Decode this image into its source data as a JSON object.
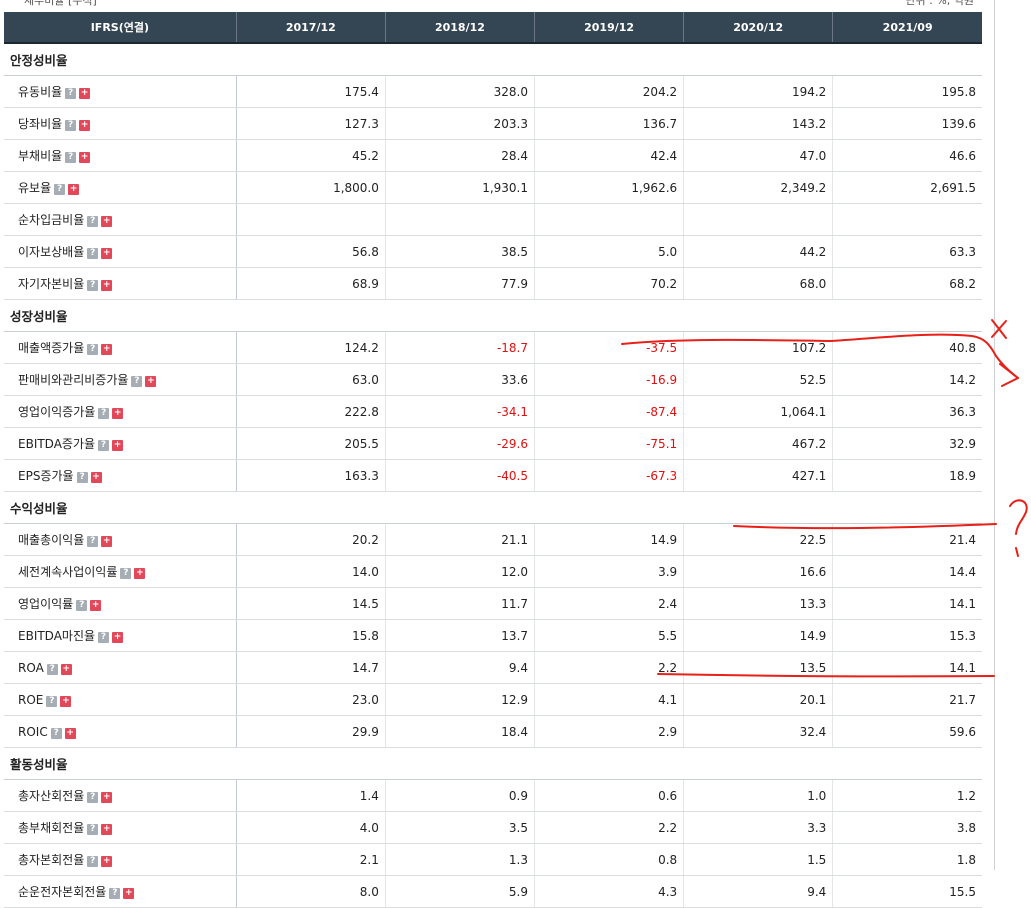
{
  "top": {
    "left_fragment": "재무비율 [누적]",
    "right_fragment": "단위 : %, 억원"
  },
  "header": [
    "IFRS(연결)",
    "2017/12",
    "2018/12",
    "2019/12",
    "2020/12",
    "2021/09"
  ],
  "sections": [
    {
      "title": "안정성비율",
      "rows": [
        {
          "label": "유동비율",
          "values": [
            "175.4",
            "328.0",
            "204.2",
            "194.2",
            "195.8"
          ]
        },
        {
          "label": "당좌비율",
          "values": [
            "127.3",
            "203.3",
            "136.7",
            "143.2",
            "139.6"
          ]
        },
        {
          "label": "부채비율",
          "values": [
            "45.2",
            "28.4",
            "42.4",
            "47.0",
            "46.6"
          ]
        },
        {
          "label": "유보율",
          "values": [
            "1,800.0",
            "1,930.1",
            "1,962.6",
            "2,349.2",
            "2,691.5"
          ]
        },
        {
          "label": "순차입금비율",
          "values": [
            "",
            "",
            "",
            "",
            ""
          ]
        },
        {
          "label": "이자보상배율",
          "values": [
            "56.8",
            "38.5",
            "5.0",
            "44.2",
            "63.3"
          ]
        },
        {
          "label": "자기자본비율",
          "values": [
            "68.9",
            "77.9",
            "70.2",
            "68.0",
            "68.2"
          ]
        }
      ]
    },
    {
      "title": "성장성비율",
      "rows": [
        {
          "label": "매출액증가율",
          "values": [
            "124.2",
            "-18.7",
            "-37.5",
            "107.2",
            "40.8"
          ]
        },
        {
          "label": "판매비와관리비증가율",
          "values": [
            "63.0",
            "33.6",
            "-16.9",
            "52.5",
            "14.2"
          ]
        },
        {
          "label": "영업이익증가율",
          "values": [
            "222.8",
            "-34.1",
            "-87.4",
            "1,064.1",
            "36.3"
          ]
        },
        {
          "label": "EBITDA증가율",
          "values": [
            "205.5",
            "-29.6",
            "-75.1",
            "467.2",
            "32.9"
          ]
        },
        {
          "label": "EPS증가율",
          "values": [
            "163.3",
            "-40.5",
            "-67.3",
            "427.1",
            "18.9"
          ]
        }
      ]
    },
    {
      "title": "수익성비율",
      "rows": [
        {
          "label": "매출총이익율",
          "values": [
            "20.2",
            "21.1",
            "14.9",
            "22.5",
            "21.4"
          ]
        },
        {
          "label": "세전계속사업이익률",
          "values": [
            "14.0",
            "12.0",
            "3.9",
            "16.6",
            "14.4"
          ]
        },
        {
          "label": "영업이익률",
          "values": [
            "14.5",
            "11.7",
            "2.4",
            "13.3",
            "14.1"
          ]
        },
        {
          "label": "EBITDA마진율",
          "values": [
            "15.8",
            "13.7",
            "5.5",
            "14.9",
            "15.3"
          ]
        },
        {
          "label": "ROA",
          "values": [
            "14.7",
            "9.4",
            "2.2",
            "13.5",
            "14.1"
          ]
        },
        {
          "label": "ROE",
          "values": [
            "23.0",
            "12.9",
            "4.1",
            "20.1",
            "21.7"
          ]
        },
        {
          "label": "ROIC",
          "values": [
            "29.9",
            "18.4",
            "2.9",
            "32.4",
            "59.6"
          ]
        }
      ]
    },
    {
      "title": "활동성비율",
      "rows": [
        {
          "label": "총자산회전율",
          "values": [
            "1.4",
            "0.9",
            "0.6",
            "1.0",
            "1.2"
          ]
        },
        {
          "label": "총부채회전율",
          "values": [
            "4.0",
            "3.5",
            "2.2",
            "3.3",
            "3.8"
          ]
        },
        {
          "label": "총자본회전율",
          "values": [
            "2.1",
            "1.3",
            "0.8",
            "1.5",
            "1.8"
          ]
        },
        {
          "label": "순운전자본회전율",
          "values": [
            "8.0",
            "5.9",
            "4.3",
            "9.4",
            "15.5"
          ]
        }
      ]
    }
  ],
  "icons": {
    "help": "question-icon",
    "expand": "plus-icon"
  },
  "colors": {
    "header_bg": "#344553",
    "negative": "#e01010",
    "annotation": "#e8201a",
    "plus_icon": "#e2485a"
  }
}
